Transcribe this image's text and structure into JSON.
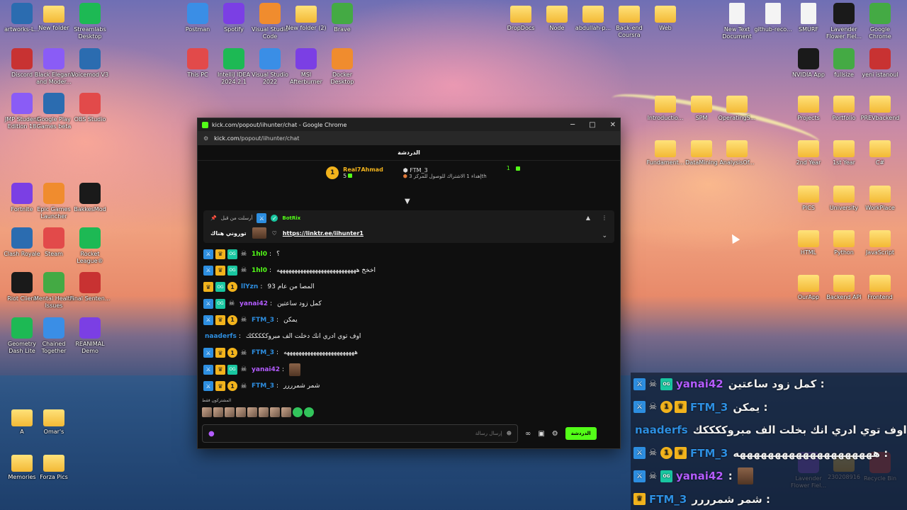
{
  "desktop": {
    "icons": [
      {
        "label": "artworks-L...",
        "icon": "image-icon"
      },
      {
        "label": "New folder",
        "icon": "folder-icon"
      },
      {
        "label": "Streamlabs Desktop",
        "icon": "streamlabs-icon"
      },
      {
        "label": "Postman",
        "icon": "postman-icon"
      },
      {
        "label": "Spotify",
        "icon": "spotify-icon"
      },
      {
        "label": "Visual Studio Code",
        "icon": "vscode-icon"
      },
      {
        "label": "New folder (2)",
        "icon": "folder-icon"
      },
      {
        "label": "Brave",
        "icon": "brave-icon"
      },
      {
        "label": "DropDocs",
        "icon": "folder-icon"
      },
      {
        "label": "Node",
        "icon": "folder-icon"
      },
      {
        "label": "abdullah-p...",
        "icon": "folder-icon"
      },
      {
        "label": "Back-end Coursra",
        "icon": "folder-icon"
      },
      {
        "label": "Web",
        "icon": "folder-icon"
      },
      {
        "label": "New Text Document",
        "icon": "text-file-icon"
      },
      {
        "label": "github-reco...",
        "icon": "text-file-icon"
      },
      {
        "label": "SMURF",
        "icon": "text-file-icon"
      },
      {
        "label": "Lavender Flower Fiel...",
        "icon": "edge-icon"
      },
      {
        "label": "Google Chrome",
        "icon": "chrome-icon"
      },
      {
        "label": "Discord",
        "icon": "discord-icon"
      },
      {
        "label": "Black Elegant and Moder...",
        "icon": "canva-icon"
      },
      {
        "label": "Voicemod V3",
        "icon": "voicemod-icon"
      },
      {
        "label": "This PC",
        "icon": "pc-icon"
      },
      {
        "label": "IntelliJ IDEA 2024.2.1",
        "icon": "intellij-icon"
      },
      {
        "label": "Visual Studio 2022",
        "icon": "visual-studio-icon"
      },
      {
        "label": "MSI Afterburner",
        "icon": "msi-icon"
      },
      {
        "label": "Docker Desktop",
        "icon": "docker-icon"
      },
      {
        "label": "NVIDIA App",
        "icon": "nvidia-icon"
      },
      {
        "label": "fullsize",
        "icon": "image-icon"
      },
      {
        "label": "yeni istanoul",
        "icon": "pdf-icon"
      },
      {
        "label": "JMP Student Edition 18",
        "icon": "jmp-icon"
      },
      {
        "label": "Google Play Games beta",
        "icon": "play-games-icon"
      },
      {
        "label": "OBS Studio",
        "icon": "obs-icon"
      },
      {
        "label": "Introductio...",
        "icon": "folder-icon"
      },
      {
        "label": "SPM",
        "icon": "folder-icon"
      },
      {
        "label": "OperatingS...",
        "icon": "folder-icon"
      },
      {
        "label": "Projects",
        "icon": "folder-icon"
      },
      {
        "label": "Portfolio",
        "icon": "folder-icon"
      },
      {
        "label": "PREVbackend",
        "icon": "folder-icon"
      },
      {
        "label": "Fundament...",
        "icon": "folder-icon"
      },
      {
        "label": "DataMining",
        "icon": "folder-icon"
      },
      {
        "label": "AnalysisOf...",
        "icon": "folder-icon"
      },
      {
        "label": "2nd Year",
        "icon": "folder-icon"
      },
      {
        "label": "1st Year",
        "icon": "folder-icon"
      },
      {
        "label": "C#",
        "icon": "folder-icon"
      },
      {
        "label": "Fortnite",
        "icon": "fortnite-icon"
      },
      {
        "label": "Epic Games Launcher",
        "icon": "epic-icon"
      },
      {
        "label": "BakkesMod",
        "icon": "bakkesmod-icon"
      },
      {
        "label": "PICS",
        "icon": "folder-icon"
      },
      {
        "label": "University",
        "icon": "folder-icon"
      },
      {
        "label": "WorkPlace",
        "icon": "folder-icon"
      },
      {
        "label": "Clash Royale",
        "icon": "clash-icon"
      },
      {
        "label": "Steam",
        "icon": "steam-icon"
      },
      {
        "label": "Rocket League®",
        "icon": "rocket-league-icon"
      },
      {
        "label": "HTML",
        "icon": "folder-icon"
      },
      {
        "label": "Python",
        "icon": "folder-icon"
      },
      {
        "label": "JavaScript",
        "icon": "folder-icon"
      },
      {
        "label": "Riot Client",
        "icon": "riot-icon"
      },
      {
        "label": "Mental Health Issues",
        "icon": "valorant-icon"
      },
      {
        "label": "Final Senten...",
        "icon": "fs-icon"
      },
      {
        "label": "OurApp",
        "icon": "folder-icon"
      },
      {
        "label": "Backend API",
        "icon": "folder-icon"
      },
      {
        "label": "Frontend",
        "icon": "folder-icon"
      },
      {
        "label": "Geometry Dash Lite",
        "icon": "geometry-dash-icon"
      },
      {
        "label": "Chained Together",
        "icon": "chained-icon"
      },
      {
        "label": "REANIMAL Demo",
        "icon": "reanimal-icon"
      },
      {
        "label": "A",
        "icon": "folder-icon"
      },
      {
        "label": "Omar's",
        "icon": "folder-icon"
      },
      {
        "label": "Memories",
        "icon": "folder-icon"
      },
      {
        "label": "Forza Pics",
        "icon": "folder-icon"
      },
      {
        "label": "Lavender Flower Fiel...",
        "icon": "image-icon"
      },
      {
        "label": "230208916",
        "icon": "folder-icon"
      },
      {
        "label": "Recycle Bin",
        "icon": "recycle-bin-icon"
      }
    ]
  },
  "window": {
    "title": "kick.com/popout/iihunter/chat - Google Chrome",
    "url_host": "kick.com",
    "url_path": "/popout/iihunter/chat",
    "controls": {
      "minimize": "─",
      "maximize": "□",
      "close": "✕"
    }
  },
  "chat": {
    "header": "الدردشة",
    "leaderboard": {
      "top_name": "Real7Ahmad",
      "top_count": "5",
      "second_name": "FTM_3",
      "second_count": "1",
      "rank_text": "إهداء 1 الاشتراك للوصول للمركز 3",
      "rank_suffix": "th"
    },
    "pinned": {
      "pinned_by": "أرسلت من قبل",
      "bot_name": "BotRix",
      "link": "https://linktr.ee/iihunter1",
      "caption": "توروني هناك"
    },
    "messages": [
      {
        "user": "1hl0",
        "color": "#53fc18",
        "badges": [
          "mod",
          "crown",
          "og",
          "skull"
        ],
        "text": "؟",
        "thumb": false
      },
      {
        "user": "1hl0",
        "color": "#53fc18",
        "badges": [
          "mod",
          "crown",
          "og",
          "skull"
        ],
        "text": "اخخخ هههههههههههههههههههههههههههه",
        "thumb": false
      },
      {
        "user": "llYzn",
        "color": "#2d8ee0",
        "badges": [
          "crown",
          "og",
          "one"
        ],
        "text": "المصا من عام 93",
        "thumb": false
      },
      {
        "user": "yanai42",
        "color": "#b35cff",
        "badges": [
          "mod",
          "og",
          "skull"
        ],
        "text": "كمل زود ساعتين",
        "thumb": false
      },
      {
        "user": "FTM_3",
        "color": "#2d8ee0",
        "badges": [
          "mod",
          "crown",
          "one",
          "skull"
        ],
        "text": "يمكن",
        "thumb": false
      },
      {
        "user": "naaderfs",
        "color": "#2d8ee0",
        "badges": [],
        "text": "اوف توي ادري انك دخلت الف مبروكككككك",
        "thumb": false
      },
      {
        "user": "FTM_3",
        "color": "#2d8ee0",
        "badges": [
          "mod",
          "crown",
          "one",
          "skull"
        ],
        "text": "ههههههههههههههههههههههههه",
        "thumb": false
      },
      {
        "user": "yanai42",
        "color": "#b35cff",
        "badges": [
          "mod",
          "crown",
          "og",
          "skull"
        ],
        "text": "",
        "thumb": true
      },
      {
        "user": "FTM_3",
        "color": "#2d8ee0",
        "badges": [
          "mod",
          "crown",
          "one",
          "skull"
        ],
        "text": "شمر شمرررر",
        "thumb": false
      }
    ],
    "emotes_label": "المشتركون فقط",
    "input_placeholder": "إرسال رسالة",
    "send_label": "الدردشة"
  },
  "overlay": {
    "rows": [
      {
        "user": "yanai42",
        "color": "#b35cff",
        "badges": [
          "mod",
          "skull",
          "og"
        ],
        "text": "كمل زود ساعتين :",
        "thumb": false
      },
      {
        "user": "FTM_3",
        "color": "#2d8ee0",
        "badges": [
          "mod",
          "skull",
          "one",
          "crown"
        ],
        "text": "يمكن :",
        "thumb": false
      },
      {
        "user": "naaderfs",
        "color": "#2d8ee0",
        "badges": [],
        "text": "اوف توي ادري انك بخلت الف مبروككككك :",
        "thumb": false
      },
      {
        "user": "FTM_3",
        "color": "#2d8ee0",
        "badges": [
          "mod",
          "skull",
          "one",
          "crown"
        ],
        "text": "ههههههههههههههههههههه :",
        "thumb": false
      },
      {
        "user": "yanai42",
        "color": "#b35cff",
        "badges": [
          "mod",
          "skull",
          "og"
        ],
        "text": ":",
        "thumb": true
      },
      {
        "user": "FTM_3",
        "color": "#2d8ee0",
        "badges": [
          "crown"
        ],
        "text": "شمر شمرررر :",
        "thumb": false
      }
    ]
  }
}
